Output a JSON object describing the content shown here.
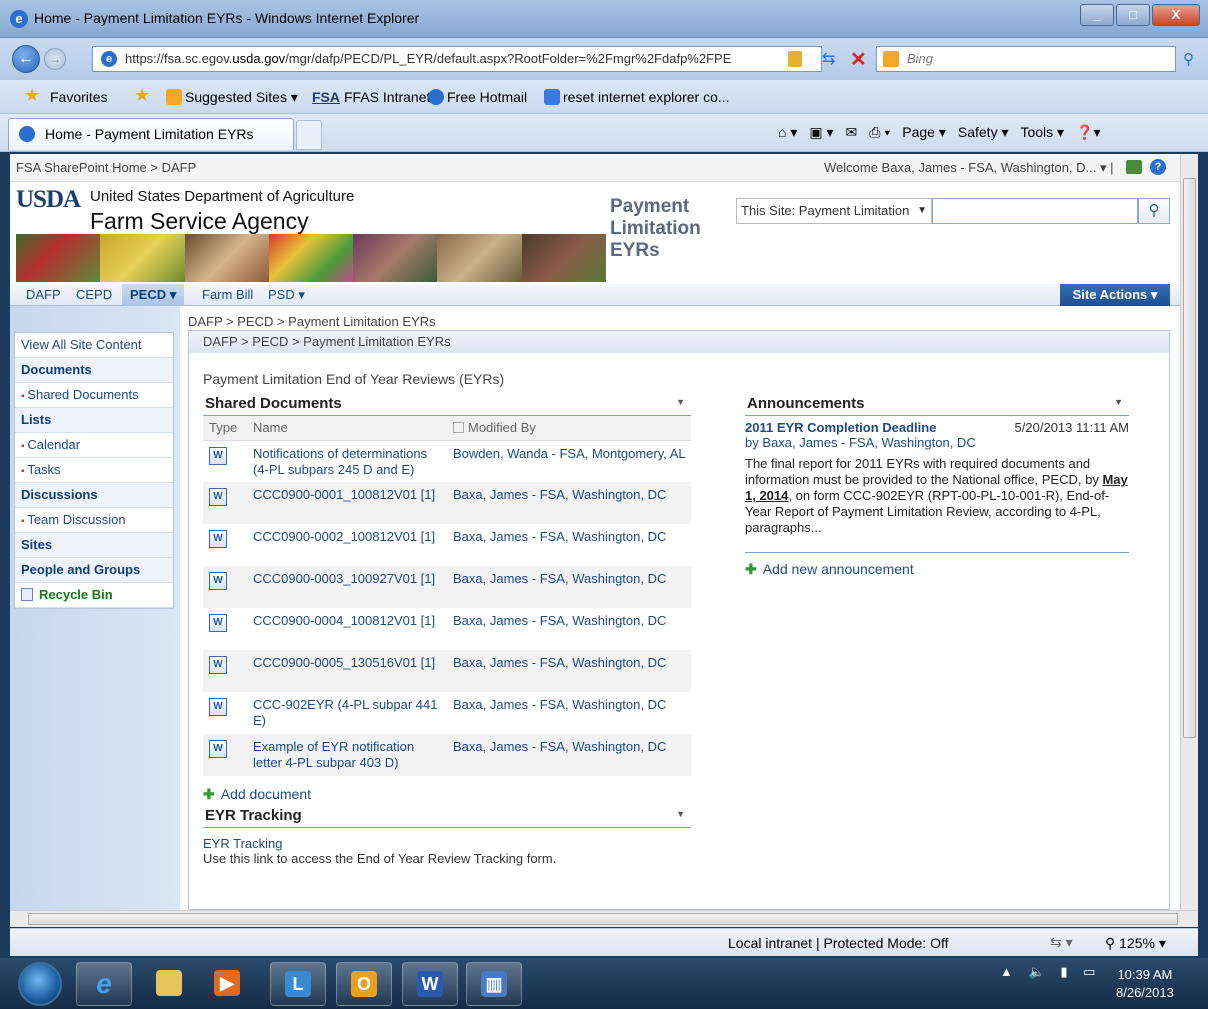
{
  "window": {
    "title": "Home - Payment Limitation EYRs - Windows Internet Explorer",
    "controls": {
      "minimize": "_",
      "maximize": "□",
      "close": "X"
    }
  },
  "browser": {
    "url_prefix": "https://fsa.sc.egov.",
    "url_domain": "usda.gov",
    "url_suffix": "/mgr/dafp/PECD/PL_EYR/default.aspx?RootFolder=%2Fmgr%2Fdafp%2FPE",
    "search_engine": "Bing",
    "favorites_label": "Favorites",
    "favorites": [
      {
        "label": "Suggested Sites ▾",
        "icon": "suggested-sites-icon"
      },
      {
        "label": "FFAS Intranet",
        "icon": "fsa-logo-icon",
        "prefix": "FSA"
      },
      {
        "label": "Free Hotmail",
        "icon": "ie-icon"
      },
      {
        "label": "reset internet explorer co...",
        "icon": "google-icon"
      }
    ],
    "tab_label": "Home - Payment Limitation EYRs",
    "commands": [
      "Page ▾",
      "Safety ▾",
      "Tools ▾"
    ],
    "status_zone": "Local intranet | Protected Mode: Off",
    "zoom": "125%"
  },
  "sharepoint": {
    "top_breadcrumb": "FSA SharePoint Home > DAFP",
    "welcome": "Welcome Baxa, James - FSA, Washington, D... ▾ |",
    "agency_abbr": "USDA",
    "department": "United States Department of Agriculture",
    "agency": "Farm Service Agency",
    "site_title": "Payment Limitation EYRs",
    "search_scope": "This Site: Payment Limitation",
    "search_value": "",
    "top_nav": [
      "DAFP",
      "CEPD",
      "PECD ▾",
      "Farm Bill",
      "PSD ▾"
    ],
    "site_actions": "Site Actions ▾",
    "breadcrumb": "DAFP > PECD > Payment Limitation EYRs",
    "quick_launch": {
      "view_all": "View All Site Content",
      "documents": "Documents",
      "shared_documents": "Shared Documents",
      "lists": "Lists",
      "calendar": "Calendar",
      "tasks": "Tasks",
      "discussions": "Discussions",
      "team_discussion": "Team Discussion",
      "sites": "Sites",
      "people_groups": "People and Groups",
      "recycle_bin": "Recycle Bin"
    },
    "page_description": "Payment Limitation End of Year Reviews (EYRs)",
    "shared_docs": {
      "title": "Shared Documents",
      "col_type": "Type",
      "col_name": "Name",
      "col_modified": "Modified By",
      "rows": [
        {
          "name": "Notifications of determinations (4-PL subpars 245 D and E)",
          "modified": "Bowden, Wanda - FSA, Montgomery, AL"
        },
        {
          "name": "CCC0900-0001_100812V01 [1]",
          "modified": "Baxa, James - FSA, Washington, DC"
        },
        {
          "name": "CCC0900-0002_100812V01 [1]",
          "modified": "Baxa, James - FSA, Washington, DC"
        },
        {
          "name": "CCC0900-0003_100927V01 [1]",
          "modified": "Baxa, James - FSA, Washington, DC"
        },
        {
          "name": "CCC0900-0004_100812V01 [1]",
          "modified": "Baxa, James - FSA, Washington, DC"
        },
        {
          "name": "CCC0900-0005_130516V01 [1]",
          "modified": "Baxa, James - FSA, Washington, DC"
        },
        {
          "name": "CCC-902EYR (4-PL subpar 441 E)",
          "modified": "Baxa, James - FSA, Washington, DC"
        },
        {
          "name": "Example of EYR notification letter 4-PL subpar 403 D)",
          "modified": "Baxa, James - FSA, Washington, DC"
        }
      ],
      "add_label": "Add document"
    },
    "announcements": {
      "title": "Announcements",
      "item_title": "2011 EYR Completion Deadline",
      "item_date": "5/20/2013 11:11 AM",
      "item_by": "by Baxa, James - FSA, Washington, DC",
      "body_1": "The final report for 2011 EYRs with required documents and information must be provided to the National office, PECD, by ",
      "body_date": "May 1, 2014",
      "body_2": ", on form CCC-902EYR (RPT-00-PL-10-001-R), End-of-Year Report of Payment Limitation Review, according to 4-PL, paragraphs...",
      "add_label": "Add new announcement"
    },
    "eyr_tracking": {
      "title": "EYR Tracking",
      "link": "EYR Tracking",
      "desc": "Use this link to access the End of Year Review Tracking form."
    }
  },
  "taskbar": {
    "time": "10:39 AM",
    "date": "8/26/2013"
  },
  "colors": {
    "link": "#1d4a84",
    "site_actions": "#1f4f8f",
    "quick_launch_bg": "#c6d7ee"
  }
}
